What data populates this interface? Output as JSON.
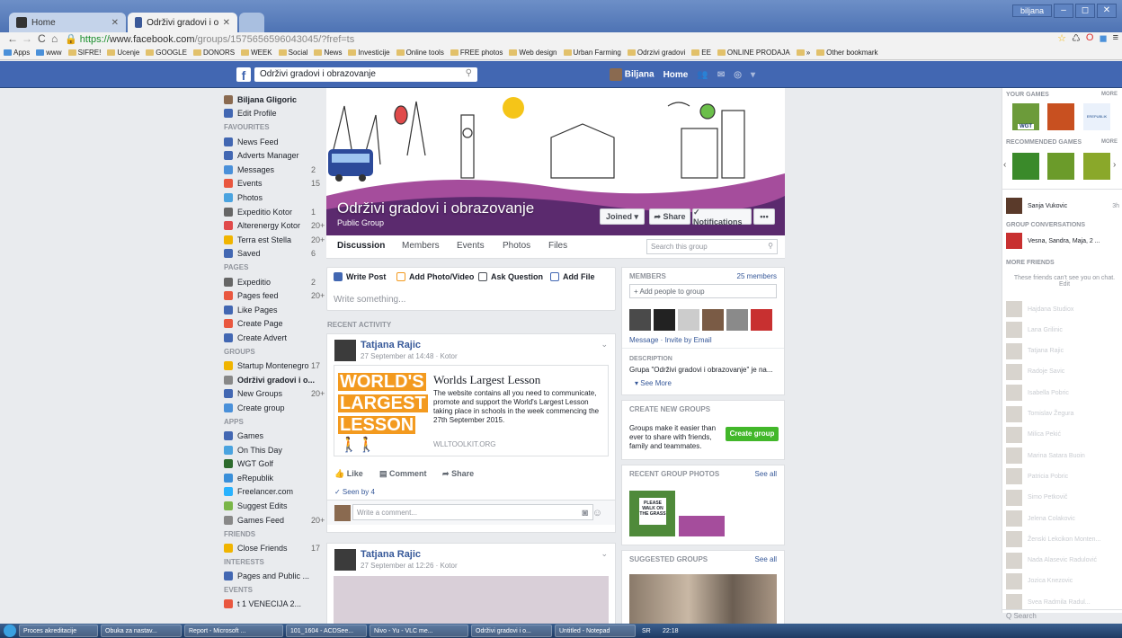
{
  "browser": {
    "tabs": [
      {
        "label": "Home"
      },
      {
        "label": "Održivi gradovi i obrazov..."
      }
    ],
    "user": "biljana",
    "url": {
      "scheme": "https://",
      "host": "www.facebook.com",
      "path": "/groups/1575656596043045/?fref=ts"
    },
    "bookmarks": [
      "Apps",
      "www",
      "SIFRE!",
      "Ucenje",
      "GOOGLE",
      "DONORS",
      "WEEK",
      "Social",
      "News",
      "Investicije",
      "Online tools",
      "FREE photos",
      "Web design",
      "Urban Farming",
      "Odrzivi gradovi",
      "EE",
      "ONLINE PRODAJA",
      "»",
      "Other bookmark"
    ]
  },
  "fb": {
    "search_value": "Održivi gradovi i obrazovanje",
    "user_name": "Biljana",
    "home": "Home"
  },
  "left": {
    "profile_name": "Biljana Gligoric",
    "edit_profile": "Edit Profile",
    "favourites_h": "FAVOURITES",
    "favourites": [
      {
        "label": "News Feed",
        "count": "",
        "color": "#4267b2"
      },
      {
        "label": "Adverts Manager",
        "count": "",
        "color": "#4267b2"
      },
      {
        "label": "Messages",
        "count": "2",
        "color": "#4a90d9"
      },
      {
        "label": "Events",
        "count": "15",
        "color": "#e9573f"
      },
      {
        "label": "Photos",
        "count": "",
        "color": "#4aa3df"
      },
      {
        "label": "Expeditio Kotor",
        "count": "1",
        "color": "#666"
      },
      {
        "label": "Alterenergy Kotor",
        "count": "20+",
        "color": "#e04a4a"
      },
      {
        "label": "Terra est Stella",
        "count": "20+",
        "color": "#f0b400"
      },
      {
        "label": "Saved",
        "count": "6",
        "color": "#4267b2"
      }
    ],
    "pages_h": "PAGES",
    "pages": [
      {
        "label": "Expeditio",
        "count": "2",
        "color": "#666"
      },
      {
        "label": "Pages feed",
        "count": "20+",
        "color": "#e9573f"
      },
      {
        "label": "Like Pages",
        "count": "",
        "color": "#4267b2"
      },
      {
        "label": "Create Page",
        "count": "",
        "color": "#e9573f"
      },
      {
        "label": "Create Advert",
        "count": "",
        "color": "#4267b2"
      }
    ],
    "groups_h": "GROUPS",
    "groups": [
      {
        "label": "Startup Montenegro",
        "count": "17",
        "color": "#f0b400"
      },
      {
        "label": "Održivi gradovi i o...",
        "count": "",
        "color": "#888",
        "bold": true
      },
      {
        "label": "New Groups",
        "count": "20+",
        "color": "#4267b2"
      },
      {
        "label": "Create group",
        "count": "",
        "color": "#4a90d9"
      }
    ],
    "apps_h": "APPS",
    "apps": [
      {
        "label": "Games",
        "count": "",
        "color": "#4267b2"
      },
      {
        "label": "On This Day",
        "count": "",
        "color": "#4aa3df"
      },
      {
        "label": "WGT Golf",
        "count": "",
        "color": "#2d6b2d"
      },
      {
        "label": "eRepublik",
        "count": "",
        "color": "#3a8fd9"
      },
      {
        "label": "Freelancer.com",
        "count": "",
        "color": "#29b2fe"
      },
      {
        "label": "Suggest Edits",
        "count": "",
        "color": "#7ab648"
      },
      {
        "label": "Games Feed",
        "count": "20+",
        "color": "#888"
      }
    ],
    "friends_h": "FRIENDS",
    "friends": [
      {
        "label": "Close Friends",
        "count": "17",
        "color": "#f0b400"
      }
    ],
    "interests_h": "INTERESTS",
    "interests": [
      {
        "label": "Pages and Public ...",
        "count": "",
        "color": "#4267b2"
      }
    ],
    "events_h": "EVENTS",
    "events": [
      {
        "label": "t 1 VENECIJA 2...",
        "count": "",
        "color": "#e9573f"
      }
    ]
  },
  "group": {
    "title": "Održivi gradovi i obrazovanje",
    "type": "Public Group",
    "joined": "Joined ▾",
    "share": "Share",
    "notifications": "✓ Notifications",
    "more": "•••",
    "tabs": [
      "Discussion",
      "Members",
      "Events",
      "Photos",
      "Files"
    ],
    "search_placeholder": "Search this group"
  },
  "composer": {
    "write_post": "Write Post",
    "add_photo": "Add Photo/Video",
    "ask": "Ask Question",
    "add_file": "Add File",
    "placeholder": "Write something..."
  },
  "recent_activity": "RECENT ACTIVITY",
  "posts": [
    {
      "author": "Tatjana Rajic",
      "meta": "27 September at 14:48 · Kotor",
      "link": {
        "img_words": [
          "WORLD'S",
          "LARGEST",
          "LESSON"
        ],
        "title": "Worlds Largest Lesson",
        "desc": "The website contains all you need to communicate, promote and support the World's Largest Lesson taking place in schools in the week commencing the 27th September 2015.",
        "site": "WLLTOOLKIT.ORG"
      },
      "like": "Like",
      "comment": "Comment",
      "share": "Share",
      "seen": "✓ Seen by 4",
      "comment_placeholder": "Write a comment..."
    },
    {
      "author": "Tatjana Rajic",
      "meta": "27 September at 12:26 · Kotor"
    }
  ],
  "members": {
    "h": "MEMBERS",
    "count": "25 members",
    "add": "+ Add people to group",
    "links": "Message · Invite by Email",
    "desc_h": "DESCRIPTION",
    "desc": "Grupa \"Održivi gradovi i obrazovanje\" je na...",
    "see_more": "▾ See More"
  },
  "create_groups": {
    "h": "CREATE NEW GROUPS",
    "text": "Groups make it easier than ever to share with friends, family and teammates.",
    "button": "Create group"
  },
  "recent_photos": {
    "h": "RECENT GROUP PHOTOS",
    "see_all": "See all",
    "sign": "PLEASE WALK ON THE GRASS"
  },
  "suggested": {
    "h": "SUGGESTED GROUPS",
    "see_all": "See all"
  },
  "right": {
    "your_games": "YOUR GAMES",
    "more": "MORE",
    "wgt": "WGT",
    "erepublik": "EREPUBLIK",
    "recommended": "RECOMMENDED GAMES",
    "chat_user": "Sanja Vukovic",
    "chat_time": "3h",
    "group_conv": "GROUP CONVERSATIONS",
    "conv": "Vesna, Sandra, Maja, 2 ...",
    "more_friends": "MORE FRIENDS",
    "offline_note": "These friends can't see you on chat. Edit",
    "friends": [
      "Hajdana Studiox",
      "Lana Grilinic",
      "Tatjana Rajic",
      "Radoje Savic",
      "Isabella Pobric",
      "Tomislav Žegura",
      "Milica Pekić",
      "Marina Satara Buoin",
      "Patricia Pobric",
      "Simo Petkovič",
      "Jelena Colakovic",
      "Ženski Lekcikon Monten...",
      "Nada Alasevic Radulović",
      "Jozica Knezovic",
      "Svea Radmila Radul..."
    ],
    "search": "Q Search"
  },
  "taskbar": [
    "Proces akreditacije",
    "Obuka za nastav...",
    "Report - Microsoft ...",
    "101_1604 - ACDSee...",
    "Nivo - Yu - VLC me...",
    "Održivi gradovi i o...",
    "Untitled - Notepad",
    "SR",
    "22:18"
  ]
}
